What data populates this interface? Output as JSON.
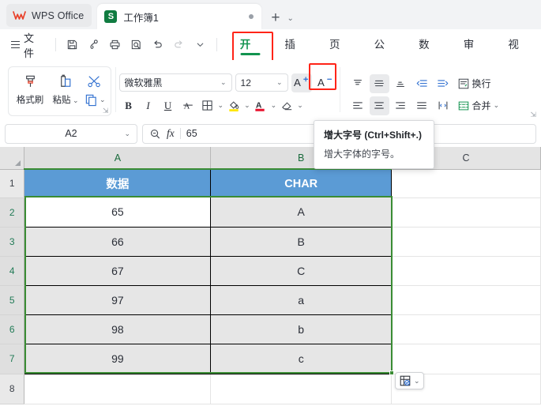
{
  "titlebar": {
    "brand": "WPS Office",
    "brand_logo_icon": "wps-logo-icon",
    "doc_tab": {
      "title": "工作簿1",
      "badge": "S",
      "modified_dot": "•"
    },
    "new_tab_icon": "plus-icon",
    "tabs_menu_icon": "chevron-down-icon"
  },
  "menubar": {
    "file_label": "文件",
    "hamburger_icon": "hamburger-icon",
    "quick_access": [
      {
        "name": "save-icon",
        "label": "保存"
      },
      {
        "name": "share-icon",
        "label": "分享"
      },
      {
        "name": "print-icon",
        "label": "打印"
      },
      {
        "name": "print-preview-icon",
        "label": "打印预览"
      },
      {
        "name": "undo-icon",
        "label": "撤销"
      },
      {
        "name": "redo-icon",
        "label": "恢复"
      },
      {
        "name": "chevron-down-icon",
        "label": "更多"
      }
    ],
    "tabs": [
      {
        "label": "开始",
        "active": true
      },
      {
        "label": "插入",
        "active": false
      },
      {
        "label": "页面",
        "active": false
      },
      {
        "label": "公式",
        "active": false
      },
      {
        "label": "数据",
        "active": false
      },
      {
        "label": "审阅",
        "active": false
      },
      {
        "label": "视图",
        "active": false
      }
    ],
    "active_tab_color": "#12934f",
    "highlight_color": "#ff2418"
  },
  "ribbon": {
    "clipboard": {
      "format_painter": "格式刷",
      "paste": "粘贴",
      "cut_icon": "scissors-icon",
      "copy_icon": "copy-icon"
    },
    "font": {
      "font_name": "微软雅黑",
      "font_size": "12",
      "increase_font_icon": "increase-font-size-icon",
      "decrease_font_icon": "decrease-font-size-icon",
      "bold": "B",
      "italic": "I",
      "underline": "U",
      "strikethrough_icon": "strikethrough-icon",
      "borders_icon": "borders-icon",
      "fill_color_icon": "fill-color-icon",
      "font_color_icon": "font-color-icon",
      "clear_format_icon": "clear-format-icon",
      "fill_color": "#ffe600",
      "font_color": "#e8112d"
    },
    "alignment": {
      "align_top_icon": "align-top-icon",
      "align_middle_icon": "align-middle-icon",
      "align_bottom_icon": "align-bottom-icon",
      "decrease_indent_icon": "decrease-indent-icon",
      "increase_indent_icon": "increase-indent-icon",
      "wrap_text": "换行",
      "align_left_icon": "align-left-icon",
      "align_center_icon": "align-center-icon",
      "align_right_icon": "align-right-icon",
      "justify_icon": "justify-icon",
      "orientation_icon": "text-orientation-icon",
      "merge": "合并"
    }
  },
  "tooltip": {
    "title": "增大字号 (Ctrl+Shift+.)",
    "description": "增大字体的字号。"
  },
  "formula_bar": {
    "name_box": "A2",
    "zoom_icon": "find-zoom-icon",
    "fx_symbol": "fx",
    "formula_value": "65"
  },
  "sheet": {
    "columns": [
      "A",
      "B",
      "C"
    ],
    "selected_columns": [
      "A",
      "B"
    ],
    "rows": [
      "1",
      "2",
      "3",
      "4",
      "5",
      "6",
      "7",
      "8"
    ],
    "selected_rows": [
      "2",
      "3",
      "4",
      "5",
      "6",
      "7"
    ],
    "header_row": {
      "a": "数据",
      "b": "CHAR"
    },
    "data": [
      {
        "row": "2",
        "a": "65",
        "b": "A"
      },
      {
        "row": "3",
        "a": "66",
        "b": "B"
      },
      {
        "row": "4",
        "a": "67",
        "b": "C"
      },
      {
        "row": "5",
        "a": "97",
        "b": "a"
      },
      {
        "row": "6",
        "a": "98",
        "b": "b"
      },
      {
        "row": "7",
        "a": "99",
        "b": "c"
      }
    ],
    "active_cell": "A2",
    "selection_range": "A2:B7",
    "header_fill_color": "#5b9bd5",
    "selection_border_color": "#3a8c34",
    "quick_analysis_icon": "quick-analysis-icon",
    "quick_analysis_caret_icon": "chevron-down-icon"
  }
}
